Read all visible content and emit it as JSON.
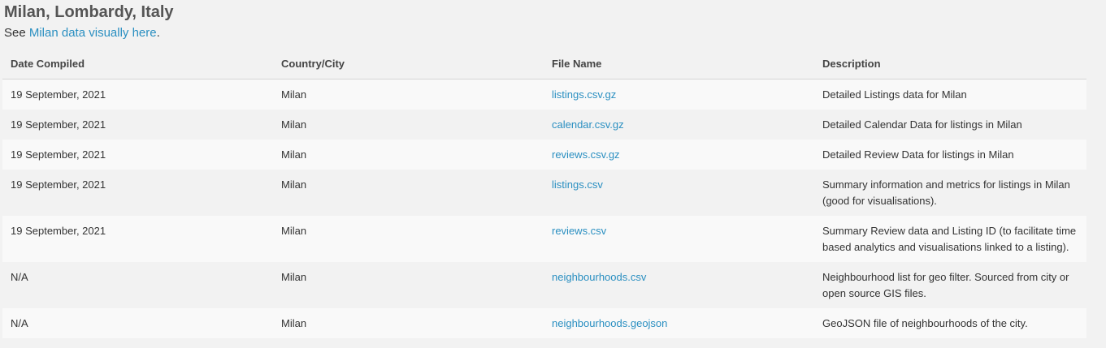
{
  "header": {
    "title": "Milan, Lombardy, Italy",
    "see_prefix": "See ",
    "see_link": "Milan data visually here",
    "see_suffix": "."
  },
  "table": {
    "columns": [
      "Date Compiled",
      "Country/City",
      "File Name",
      "Description"
    ],
    "rows": [
      {
        "date": "19 September, 2021",
        "city": "Milan",
        "file": "listings.csv.gz",
        "description": "Detailed Listings data for Milan"
      },
      {
        "date": "19 September, 2021",
        "city": "Milan",
        "file": "calendar.csv.gz",
        "description": "Detailed Calendar Data for listings in Milan"
      },
      {
        "date": "19 September, 2021",
        "city": "Milan",
        "file": "reviews.csv.gz",
        "description": "Detailed Review Data for listings in Milan"
      },
      {
        "date": "19 September, 2021",
        "city": "Milan",
        "file": "listings.csv",
        "description": "Summary information and metrics for listings in Milan (good for visualisations)."
      },
      {
        "date": "19 September, 2021",
        "city": "Milan",
        "file": "reviews.csv",
        "description": "Summary Review data and Listing ID (to facilitate time based analytics and visualisations linked to a listing)."
      },
      {
        "date": "N/A",
        "city": "Milan",
        "file": "neighbourhoods.csv",
        "description": "Neighbourhood list for geo filter. Sourced from city or open source GIS files."
      },
      {
        "date": "N/A",
        "city": "Milan",
        "file": "neighbourhoods.geojson",
        "description": "GeoJSON file of neighbourhoods of the city."
      }
    ]
  },
  "colors": {
    "link": "#2a8fc1",
    "background": "#f2f2f2",
    "row_alt": "#f9f9f9"
  }
}
